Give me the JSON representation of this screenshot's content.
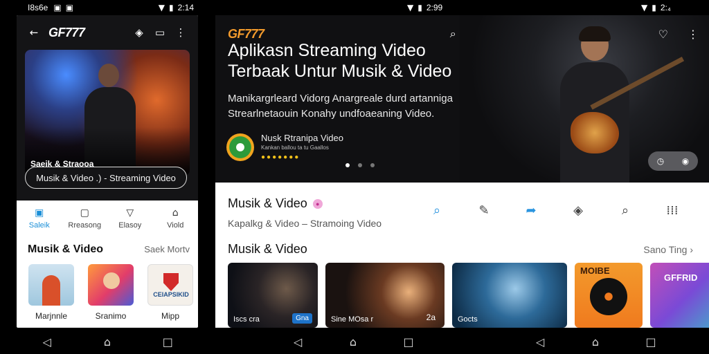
{
  "phone": {
    "status": {
      "left_text": "I8s6e",
      "time": "2:14"
    },
    "appbar": {
      "brand": "GF777"
    },
    "hero": {
      "caption": "Saeik & Straooa"
    },
    "pill": "Musik & Video .)  - Streaming Video",
    "tabs": [
      {
        "label": "Saleik"
      },
      {
        "label": "Rreasong"
      },
      {
        "label": "Elasoy"
      },
      {
        "label": "Viold"
      }
    ],
    "section": {
      "title": "Musik & Video",
      "more": "Saek Mortv"
    },
    "thumbs": [
      {
        "label": "Marjnnle"
      },
      {
        "label": "Sranimo"
      },
      {
        "label": "Mipp",
        "art_text": "CEIAPSIKID"
      }
    ]
  },
  "tablet": {
    "status": {
      "time_mid": "2:99",
      "time_right": "2:₄"
    },
    "appbar": {
      "brand": "GF777"
    },
    "hero": {
      "title": "Aplikasn Streaming Video Terbaak Untur Musik & Video",
      "desc": "Manikargrleard Vidorg Anargreale durd artanniga Strearlnetaouin Konahy undfoaeaning Video.",
      "app_name": "Nusk Rtranipa Video",
      "app_sub": "Kankan ballou ta tu Gaallos"
    },
    "info": {
      "title": "Musik & Video",
      "subtitle": "Kapalkg & Video – Stramoing Video"
    },
    "section": {
      "title": "Musik & Video",
      "more": "Sano Ting"
    },
    "cards": [
      {
        "label": "Iscs cra",
        "tag": "Gna"
      },
      {
        "label": "Sine MOsa r",
        "tag": "2a",
        "tag_plain": true
      },
      {
        "label": "Gocts",
        "tag": ""
      },
      {
        "label": "",
        "art_text": "MOIBE"
      },
      {
        "label": "",
        "art_text": "GFFRID"
      }
    ]
  },
  "colors": {
    "accent_blue": "#2a94df",
    "brand_orange": "#f29a2c",
    "dark_bg": "#141416"
  },
  "icons": [
    "back-arrow-icon",
    "diamond-icon",
    "chat-icon",
    "more-vert-icon",
    "search-icon",
    "heart-icon",
    "edit-icon",
    "share-icon",
    "compass-icon",
    "grid-icon",
    "chevron-right-icon",
    "back-triangle-icon",
    "home-icon",
    "recents-icon"
  ]
}
